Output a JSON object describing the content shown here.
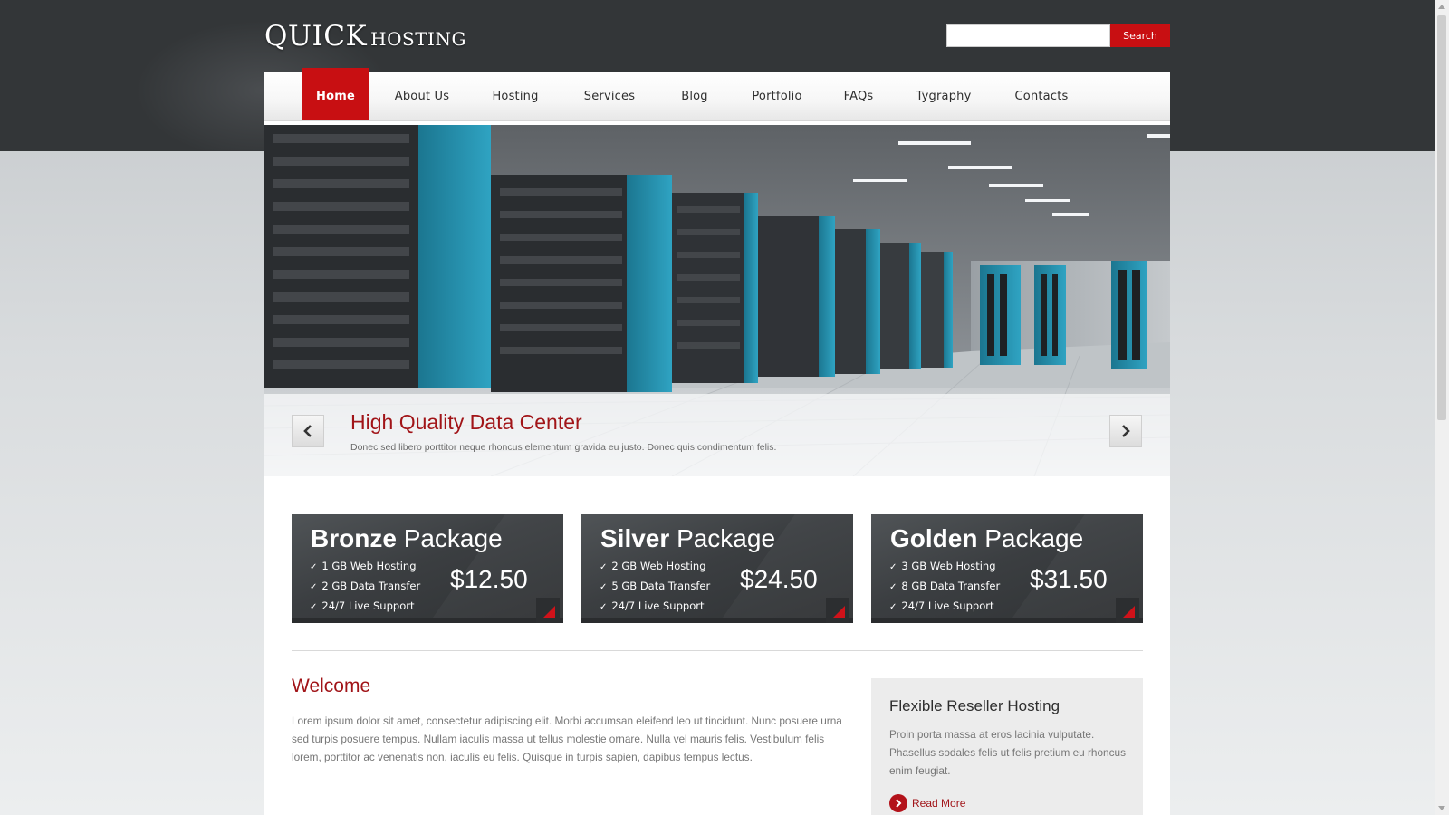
{
  "header": {
    "logo_main": "QUICK",
    "logo_sub": "HOSTING",
    "search_placeholder": "",
    "search_button": "Search"
  },
  "nav": {
    "items": [
      "Home",
      "About Us",
      "Hosting",
      "Services",
      "Blog",
      "Portfolio",
      "FAQs",
      "Tygraphy",
      "Contacts"
    ],
    "active": "Home"
  },
  "slider": {
    "title": "High Quality Data Center",
    "text": "Donec sed libero porttitor neque rhoncus elementum gravida eu justo. Donec quis condimentum felis."
  },
  "packages": [
    {
      "name": "Bronze",
      "suffix": "Package",
      "features": [
        "1 GB Web Hosting",
        "2 GB Data Transfer",
        "24/7 Live Support"
      ],
      "price": "$12.50"
    },
    {
      "name": "Silver",
      "suffix": "Package",
      "features": [
        "2 GB Web Hosting",
        "5 GB Data Transfer",
        "24/7 Live Support"
      ],
      "price": "$24.50"
    },
    {
      "name": "Golden",
      "suffix": "Package",
      "features": [
        "3 GB Web Hosting",
        "8 GB Data Transfer",
        "24/7 Live Support"
      ],
      "price": "$31.50"
    }
  ],
  "welcome": {
    "title": "Welcome",
    "text": "Lorem ipsum dolor sit amet, consectetur adipiscing elit. Morbi accumsan eleifend leo ut tincidunt. Nunc posuere urna sed turpis posuere tempus. Nullam iaculis massa ut tellus molestie ornare. Nulla vel mauris felis. Vestibulum felis lorem, porttitor ac venenatis non, iaculis eu felis. Quisque in turpis sapien, dapibus tempus lectus."
  },
  "reseller": {
    "title": "Flexible Reseller Hosting",
    "text": "Proin porta massa at eros lacinia vulputate. Phasellus sodales felis ut felis pretium eu rhoncus enim feugiat.",
    "read_more": "Read More"
  },
  "icons": {
    "check": "check-icon",
    "prev": "chevron-left-icon",
    "next": "chevron-right-icon",
    "corner": "corner-arrow-icon",
    "read_more": "chevron-right-circle-icon"
  },
  "colors": {
    "brand_red": "#c80f12",
    "title_red": "#a11418",
    "dark": "#333638"
  }
}
